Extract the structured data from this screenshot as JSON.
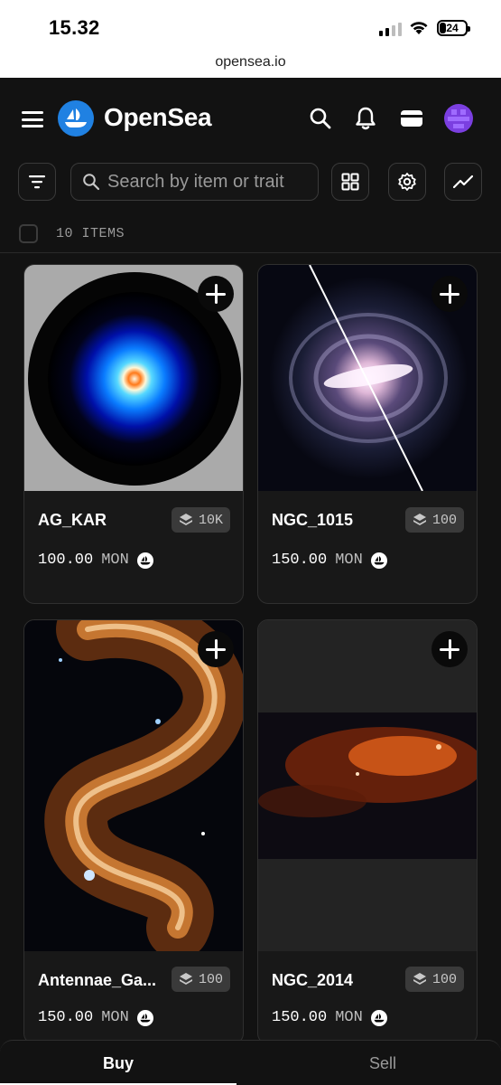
{
  "status_bar": {
    "time": "15.32",
    "battery": "24"
  },
  "browser": {
    "url": "opensea.io"
  },
  "header": {
    "brand": "OpenSea"
  },
  "toolbar": {
    "search_placeholder": "Search by item or trait"
  },
  "items": {
    "count_label": "10 ITEMS"
  },
  "cards": [
    {
      "name": "AG_KAR",
      "badge": "10K",
      "price": "100.00",
      "currency": "MON"
    },
    {
      "name": "NGC_1015",
      "badge": "100",
      "price": "150.00",
      "currency": "MON"
    },
    {
      "name": "Antennae_Ga...",
      "badge": "100",
      "price": "150.00",
      "currency": "MON"
    },
    {
      "name": "NGC_2014",
      "badge": "100",
      "price": "150.00",
      "currency": "MON"
    }
  ],
  "tabs": {
    "buy": "Buy",
    "sell": "Sell"
  },
  "colors": {
    "accent": "#2081e2",
    "background": "#121212",
    "card": "#181818"
  }
}
